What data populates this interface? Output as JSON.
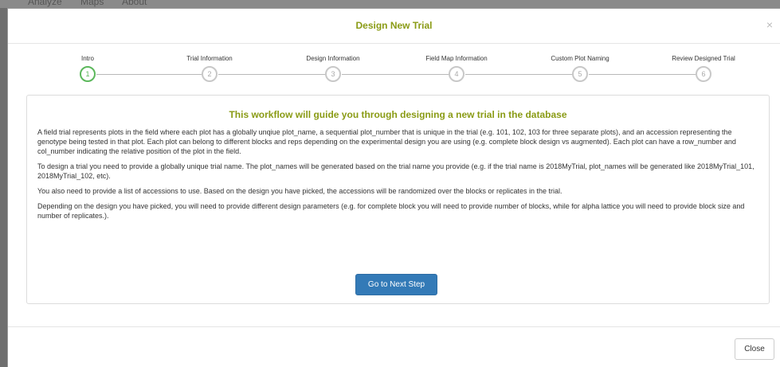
{
  "backdrop": {
    "nav_items": [
      "Analyze",
      "Maps",
      "About"
    ]
  },
  "modal": {
    "title": "Design New Trial",
    "close_icon": "×"
  },
  "steps": [
    {
      "label": "Intro",
      "number": "1"
    },
    {
      "label": "Trial Information",
      "number": "2"
    },
    {
      "label": "Design Information",
      "number": "3"
    },
    {
      "label": "Field Map Information",
      "number": "4"
    },
    {
      "label": "Custom Plot Naming",
      "number": "5"
    },
    {
      "label": "Review Designed Trial",
      "number": "6"
    }
  ],
  "content": {
    "heading": "This workflow will guide you through designing a new trial in the database",
    "paragraphs": [
      "A field trial represents plots in the field where each plot has a globally unqiue plot_name, a sequential plot_number that is unique in the trial (e.g. 101, 102, 103 for three separate plots), and an accession representing the genotype being tested in that plot. Each plot can belong to different blocks and reps depending on the experimental design you are using (e.g. complete block design vs augmented). Each plot can have a row_number and col_number indicating the relative position of the plot in the field.",
      "To design a trial you need to provide a globally unique trial name. The plot_names will be generated based on the trial name you provide (e.g. if the trial name is 2018MyTrial, plot_names will be generated like 2018MyTrial_101, 2018MyTrial_102, etc).",
      "You also need to provide a list of accessions to use. Based on the design you have picked, the accessions will be randomized over the blocks or replicates in the trial.",
      "Depending on the design you have picked, you will need to provide different design parameters (e.g. for complete block you will need to provide number of blocks, while for alpha lattice you will need to provide block size and number of replicates.)."
    ],
    "next_button": "Go to Next Step"
  },
  "footer": {
    "close_button": "Close"
  },
  "colors": {
    "accent": "#8a9b15",
    "primary": "#337ab7",
    "active_step": "#5cb85c"
  }
}
